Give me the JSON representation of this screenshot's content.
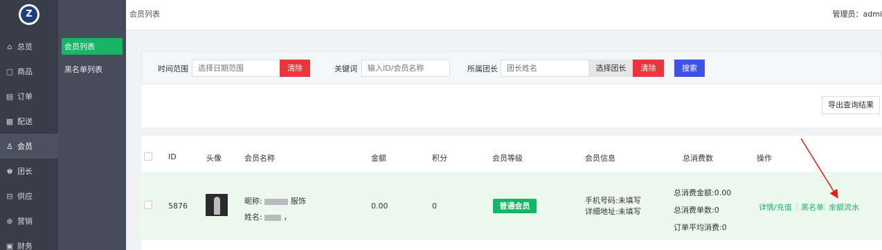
{
  "sidebar": {
    "items": [
      {
        "label": "总览",
        "icon": "home-icon",
        "glyph": "⌂"
      },
      {
        "label": "商品",
        "icon": "goods-icon",
        "glyph": "▢"
      },
      {
        "label": "订单",
        "icon": "order-icon",
        "glyph": "▤"
      },
      {
        "label": "配送",
        "icon": "delivery-icon",
        "glyph": "▦"
      },
      {
        "label": "会员",
        "icon": "member-icon",
        "glyph": "♙"
      },
      {
        "label": "团长",
        "icon": "leader-icon",
        "glyph": "♚"
      },
      {
        "label": "供应",
        "icon": "supply-icon",
        "glyph": "⊟"
      },
      {
        "label": "营销",
        "icon": "marketing-icon",
        "glyph": "⊕"
      },
      {
        "label": "财务",
        "icon": "finance-icon",
        "glyph": "▣"
      }
    ],
    "active_index": 4
  },
  "subbar": {
    "items": [
      {
        "label": "会员列表"
      },
      {
        "label": "黑名单列表"
      }
    ]
  },
  "topbar": {
    "breadcrumb": "会员列表",
    "admin": "管理员：admi"
  },
  "filter": {
    "time_label": "时间范围",
    "time_placeholder": "选择日期范围",
    "clear_label": "清除",
    "keyword_label": "关键词",
    "keyword_placeholder": "输入ID/会员名称",
    "leader_label": "所属团长",
    "leader_placeholder": "团长姓名",
    "choose_leader_label": "选择团长",
    "clear2_label": "清除",
    "search_label": "搜索"
  },
  "export_label": "导出查询结果",
  "table": {
    "headers": [
      "ID",
      "头像",
      "会员名称",
      "金额",
      "积分",
      "会员等级",
      "会员信息",
      "总消费数",
      "操作"
    ],
    "row": {
      "id": "5876",
      "nickname_prefix": "昵称:",
      "nickname_suffix": "服饰",
      "name_prefix": "姓名:",
      "name_suffix": "，",
      "amount": "0.00",
      "points": "0",
      "level": "普通会员",
      "phone": "手机号码:未填写",
      "address": "详细地址:未填写",
      "total_amount": "总消费金额:0.00",
      "total_orders": "总消费单数:0",
      "avg_spend": "订单平均消费:0",
      "op_detail": "详情/充值",
      "op_blacklist": "黑名单",
      "op_flow": "余额流水"
    }
  },
  "colors": {
    "sidebar_bg": "#393d49",
    "subbar_bg": "#474c5a",
    "accent_green": "#18b566",
    "danger_red": "#e9353b",
    "primary_blue": "#3e53e4",
    "annotation_arrow": "#e02020"
  }
}
